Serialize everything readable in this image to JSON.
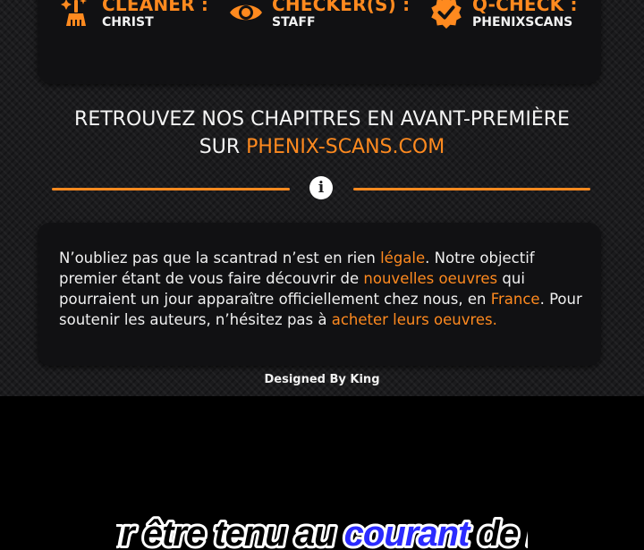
{
  "credits": [
    {
      "role": "CLEANER :",
      "name": "CHRIST",
      "icon": "cleaning-broom-icon"
    },
    {
      "role": "CHECKER(S) :",
      "name": "STAFF",
      "icon": "eye-icon"
    },
    {
      "role": "Q-CHECK :",
      "name": "PHENIXSCANS",
      "icon": "verified-badge-icon"
    }
  ],
  "headline": {
    "line1": "RETROUVEZ NOS CHAPITRES EN AVANT-PREMIÈRE",
    "line2_prefix": "SUR ",
    "line2_link": "PHENIX-SCANS.COM"
  },
  "divider": {
    "icon": "info-icon",
    "glyph": "i"
  },
  "notice": {
    "t1": "N’oubliez pas que la scantrad n’est en rien ",
    "h1": "légale",
    "t2": ". Notre objectif premier étant de vous faire découvrir de ",
    "h2": "nouvelles oeuvres",
    "t3": " qui pourraient un jour apparaître officiellement  chez nous, en ",
    "h3": "France",
    "t4": ". Pour soutenir les auteurs, n’hésitez pas à ",
    "h4": "acheter leurs oeuvres."
  },
  "footer": {
    "designer": "Designed By King"
  },
  "banner": {
    "text": "Pour être tenu au courant de nos",
    "pre": "Pour être tenu au ",
    "highlight": "courant",
    "post": " de nos"
  },
  "colors": {
    "accent": "#ff8a1f",
    "card": "#111113",
    "text": "#f0f0f0",
    "banner_highlight": "#2b2bff"
  }
}
